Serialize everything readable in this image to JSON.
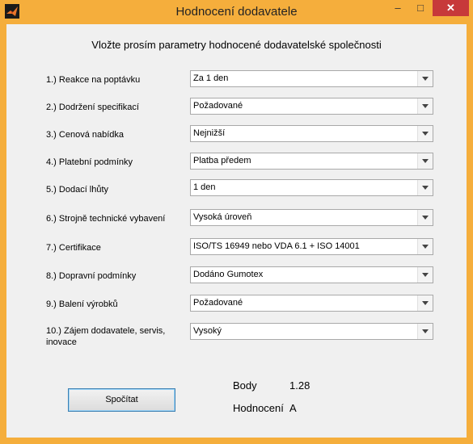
{
  "window": {
    "title": "Hodnocení dodavatele",
    "min": "–",
    "max": "□",
    "close": "✕"
  },
  "heading": "Vložte prosím parametry hodnocené dodavatelské společnosti",
  "rows": [
    {
      "label": "1.) Reakce na poptávku",
      "value": "Za 1 den"
    },
    {
      "label": "2.) Dodržení specifikací",
      "value": "Požadované"
    },
    {
      "label": "3.) Cenová nabídka",
      "value": "Nejnižší"
    },
    {
      "label": "4.) Platební podmínky",
      "value": "Platba předem"
    },
    {
      "label": "5.) Dodací lhůty",
      "value": "1 den"
    },
    {
      "label": "6.) Strojně technické vybavení",
      "value": "Vysoká úroveň"
    },
    {
      "label": "7.) Certifikace",
      "value": "ISO/TS 16949 nebo VDA 6.1 + ISO 14001"
    },
    {
      "label": "8.) Dopravní podmínky",
      "value": "Dodáno Gumotex"
    },
    {
      "label": "9.) Balení výrobků",
      "value": "Požadované"
    },
    {
      "label": "10.) Zájem dodavatele, servis,",
      "label2": "inovace",
      "value": "Vysoký"
    }
  ],
  "button": {
    "label": "Spočítat"
  },
  "results": {
    "body_label": "Body",
    "body_value": "1.28",
    "rating_label": "Hodnocení",
    "rating_value": "A"
  },
  "colors": {
    "titlebar": "#f5ae3c",
    "close": "#c7393a",
    "panel": "#f0f0f0"
  }
}
